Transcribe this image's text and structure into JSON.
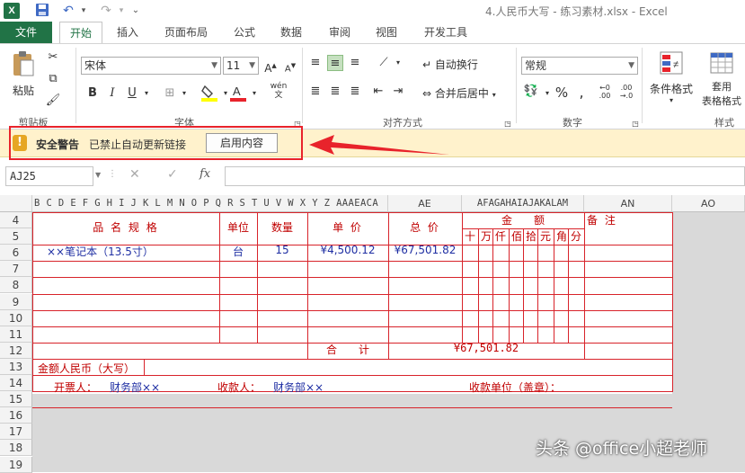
{
  "titlebar": {
    "app_icon": "X",
    "title": "4.人民币大写 - 练习素材.xlsx - Excel",
    "save_icon": "save-icon",
    "undo_icon": "undo-icon",
    "redo_icon": "redo-icon"
  },
  "tabs": [
    "文件",
    "开始",
    "插入",
    "页面布局",
    "公式",
    "数据",
    "审阅",
    "视图",
    "开发工具"
  ],
  "ribbon": {
    "paste_label": "粘贴",
    "clipboard_label": "剪贴板",
    "font_name": "宋体",
    "font_size": "11",
    "font_label": "字体",
    "wrap_label": "自动换行",
    "merge_label": "合并后居中",
    "align_label": "对齐方式",
    "number_format": "常规",
    "number_label": "数字",
    "cond_format_label": "条件格式",
    "table_format_label": "套用\n表格格式",
    "style_label": "样式",
    "phonetic_label": "wén"
  },
  "security": {
    "title": "安全警告",
    "message": "已禁止自动更新链接",
    "button": "启用内容"
  },
  "formula_bar": {
    "name_box": "AJ25",
    "fx": "fx",
    "formula": ""
  },
  "grid": {
    "col_letters": "B C D E F G H I J K L M N O P Q R S T U V W X Y Z AAAEACA",
    "col_ae": "AE",
    "col_af": "AFAGAHAIAJAKALAM",
    "col_an": "AN",
    "col_ao": "AO",
    "rows": [
      "4",
      "5",
      "6",
      "7",
      "8",
      "9",
      "10",
      "11",
      "12",
      "13",
      "14",
      "15",
      "16",
      "17",
      "18",
      "19"
    ],
    "h_name": "品 名 规 格",
    "h_unit": "单位",
    "h_qty": "数量",
    "h_price": "单 价",
    "h_total": "总 价",
    "h_amount": "金　　额",
    "h_remark": "备 注",
    "digits": [
      "十",
      "万",
      "仟",
      "佰",
      "拾",
      "元",
      "角",
      "分"
    ],
    "r6_name": "××笔记本（13.5寸）",
    "r6_unit": "台",
    "r6_qty": "15",
    "r6_price": "¥4,500.12",
    "r6_total": "¥67,501.82",
    "sum_label": "合　　计",
    "sum_value": "¥67,501.82",
    "rmb_label": "金额人民币（大写）",
    "issuer_label": "开票人：",
    "issuer": "财务部××",
    "payee_label": "收款人：",
    "payee": "财务部××",
    "unit_label": "收款单位（盖章）："
  },
  "watermark": "头条 @office小超老师",
  "colors": {
    "accent": "#217346",
    "red": "#d8232a",
    "blue": "#1f2fa3",
    "warning_bg": "#fff2cc"
  }
}
